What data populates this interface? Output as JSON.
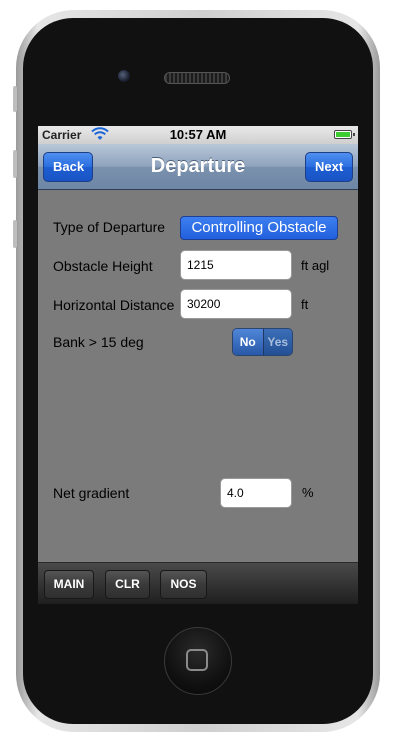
{
  "status": {
    "carrier": "Carrier",
    "time": "10:57 AM"
  },
  "nav": {
    "back_label": "Back",
    "title": "Departure",
    "next_label": "Next"
  },
  "form": {
    "departure_type_label": "Type of Departure",
    "departure_type_value": "Controlling Obstacle",
    "obstacle_height_label": "Obstacle Height",
    "obstacle_height_value": "1215",
    "obstacle_height_unit": "ft agl",
    "horizontal_distance_label": "Horizontal Distance",
    "horizontal_distance_value": "30200",
    "horizontal_distance_unit": "ft",
    "bank_label": "Bank > 15 deg",
    "bank_options": [
      "No",
      "Yes"
    ],
    "bank_selected": "No",
    "net_gradient_label": "Net gradient",
    "net_gradient_value": "4.0",
    "net_gradient_unit": "%"
  },
  "toolbar": {
    "main_label": "MAIN",
    "clr_label": "CLR",
    "nos_label": "NOS"
  },
  "colors": {
    "nav_button": "#2a6ee0",
    "screen_bg": "#7b7b7b",
    "battery": "#3ecd30"
  },
  "icons": {
    "wifi": "wifi-icon",
    "battery": "battery-icon",
    "home": "home-button-icon"
  }
}
